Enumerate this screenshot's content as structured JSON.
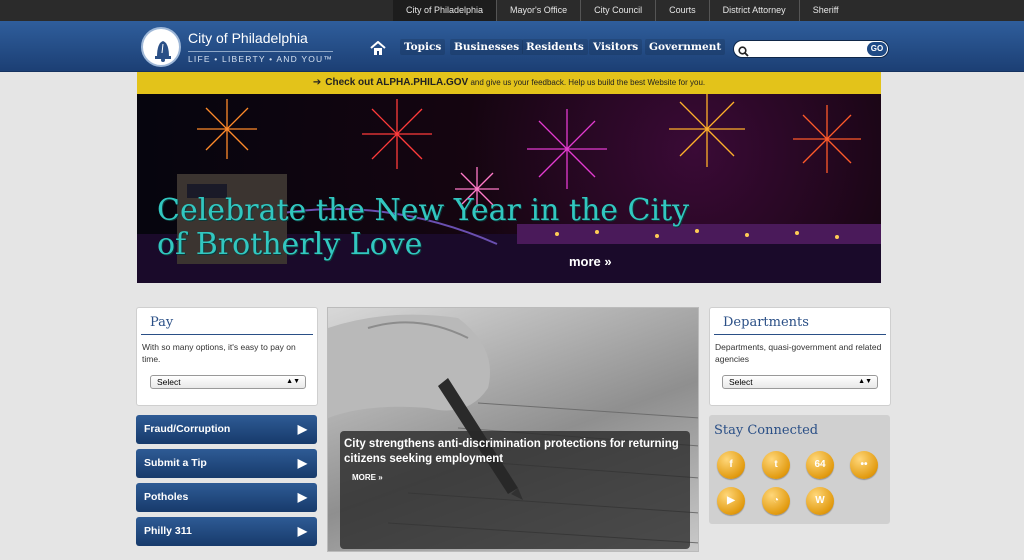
{
  "top_links": [
    "City of Philadelphia",
    "Mayor's Office",
    "City Council",
    "Courts",
    "District Attorney",
    "Sheriff"
  ],
  "logo": {
    "title": "City of Philadelphia",
    "tagline": "LIFE • LIBERTY • AND YOU™",
    "icon": "liberty-bell-icon"
  },
  "nav": {
    "home_icon": "home-icon",
    "items": [
      "Topics",
      "Businesses",
      "Residents",
      "Visitors",
      "Government"
    ]
  },
  "search": {
    "icon": "search-icon",
    "placeholder": "",
    "button": "GO"
  },
  "alert": {
    "icon": "arrow-right-icon",
    "strong": "Check out ALPHA.PHILA.GOV",
    "text": "and give us your feedback. Help us build the best Website for you."
  },
  "hero": {
    "headline": "Celebrate the New Year in the City of Brotherly Love",
    "more": "more »",
    "headline_color": "#32c7c0"
  },
  "pay": {
    "title": "Pay",
    "text": "With so many options, it's easy to pay on time.",
    "select": "Select"
  },
  "left_buttons": [
    "Fraud/Corruption",
    "Submit a Tip",
    "Potholes",
    "Philly 311"
  ],
  "feature": {
    "title": "City strengthens anti-discrimination protections for returning citizens seeking employment",
    "more": "MORE »"
  },
  "departments": {
    "title": "Departments",
    "text": "Departments, quasi-government and related agencies",
    "select": "Select"
  },
  "social": {
    "title": "Stay Connected",
    "icons": [
      {
        "name": "facebook-icon",
        "glyph": "f"
      },
      {
        "name": "twitter-icon",
        "glyph": "t"
      },
      {
        "name": "route64-icon",
        "glyph": "64"
      },
      {
        "name": "flickr-icon",
        "glyph": "••"
      },
      {
        "name": "youtube-icon",
        "glyph": "▶"
      },
      {
        "name": "rss-icon",
        "glyph": "◔"
      },
      {
        "name": "wordpress-icon",
        "glyph": "W"
      }
    ]
  },
  "colors": {
    "header_blue": "#1c3f74",
    "alert_yellow": "#e3c31a",
    "link_blue": "#2a4f86"
  }
}
